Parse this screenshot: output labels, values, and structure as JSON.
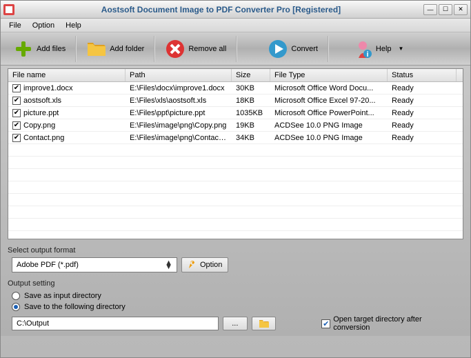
{
  "window": {
    "title": "Aostsoft Document Image to PDF Converter Pro [Registered]"
  },
  "menu": {
    "file": "File",
    "option": "Option",
    "help": "Help"
  },
  "toolbar": {
    "add_files": "Add files",
    "add_folder": "Add folder",
    "remove_all": "Remove all",
    "convert": "Convert",
    "help": "Help"
  },
  "grid": {
    "headers": {
      "filename": "File name",
      "path": "Path",
      "size": "Size",
      "filetype": "File Type",
      "status": "Status"
    },
    "rows": [
      {
        "checked": true,
        "filename": "improve1.docx",
        "path": "E:\\Files\\docx\\improve1.docx",
        "size": "30KB",
        "filetype": "Microsoft Office Word Docu...",
        "status": "Ready"
      },
      {
        "checked": true,
        "filename": "aostsoft.xls",
        "path": "E:\\Files\\xls\\aostsoft.xls",
        "size": "18KB",
        "filetype": "Microsoft Office Excel 97-20...",
        "status": "Ready"
      },
      {
        "checked": true,
        "filename": "picture.ppt",
        "path": "E:\\Files\\ppt\\picture.ppt",
        "size": "1035KB",
        "filetype": "Microsoft Office PowerPoint...",
        "status": "Ready"
      },
      {
        "checked": true,
        "filename": "Copy.png",
        "path": "E:\\Files\\image\\png\\Copy.png",
        "size": "19KB",
        "filetype": "ACDSee 10.0 PNG Image",
        "status": "Ready"
      },
      {
        "checked": true,
        "filename": "Contact.png",
        "path": "E:\\Files\\image\\png\\Contact....",
        "size": "34KB",
        "filetype": "ACDSee 10.0 PNG Image",
        "status": "Ready"
      }
    ]
  },
  "format": {
    "label": "Select output format",
    "selected": "Adobe PDF (*.pdf)",
    "option_btn": "Option"
  },
  "output": {
    "legend": "Output setting",
    "save_input": "Save as input directory",
    "save_following": "Save to the following directory",
    "path": "C:\\Output",
    "browse": "...",
    "open_target": "Open target directory after conversion"
  }
}
